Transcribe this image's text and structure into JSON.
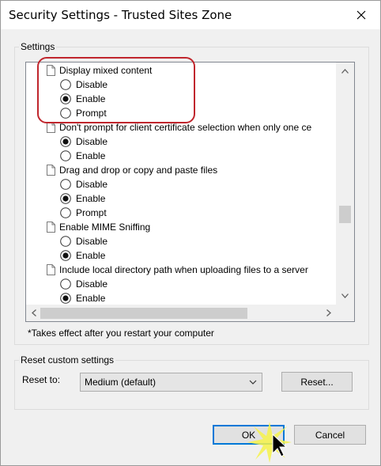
{
  "window": {
    "title": "Security Settings - Trusted Sites Zone",
    "close_icon": "close-icon"
  },
  "settings_group": {
    "label": "Settings",
    "items": [
      {
        "kind": "setting",
        "label": "Display mixed content"
      },
      {
        "kind": "option",
        "label": "Disable",
        "checked": false
      },
      {
        "kind": "option",
        "label": "Enable",
        "checked": true
      },
      {
        "kind": "option",
        "label": "Prompt",
        "checked": false
      },
      {
        "kind": "setting",
        "label": "Don't prompt for client certificate selection when only one ce"
      },
      {
        "kind": "option",
        "label": "Disable",
        "checked": true
      },
      {
        "kind": "option",
        "label": "Enable",
        "checked": false
      },
      {
        "kind": "setting",
        "label": "Drag and drop or copy and paste files"
      },
      {
        "kind": "option",
        "label": "Disable",
        "checked": false
      },
      {
        "kind": "option",
        "label": "Enable",
        "checked": true
      },
      {
        "kind": "option",
        "label": "Prompt",
        "checked": false
      },
      {
        "kind": "setting",
        "label": "Enable MIME Sniffing"
      },
      {
        "kind": "option",
        "label": "Disable",
        "checked": false
      },
      {
        "kind": "option",
        "label": "Enable",
        "checked": true
      },
      {
        "kind": "setting",
        "label": "Include local directory path when uploading files to a server"
      },
      {
        "kind": "option",
        "label": "Disable",
        "checked": false
      },
      {
        "kind": "option",
        "label": "Enable",
        "checked": true
      }
    ],
    "note": "*Takes effect after you restart your computer"
  },
  "reset_group": {
    "label": "Reset custom settings",
    "reset_to_label": "Reset to:",
    "selected_level": "Medium (default)",
    "reset_button": "Reset..."
  },
  "footer": {
    "ok_button": "OK",
    "cancel_button": "Cancel"
  },
  "colors": {
    "highlight": "#c0262d",
    "default_button_border": "#0078d7"
  }
}
